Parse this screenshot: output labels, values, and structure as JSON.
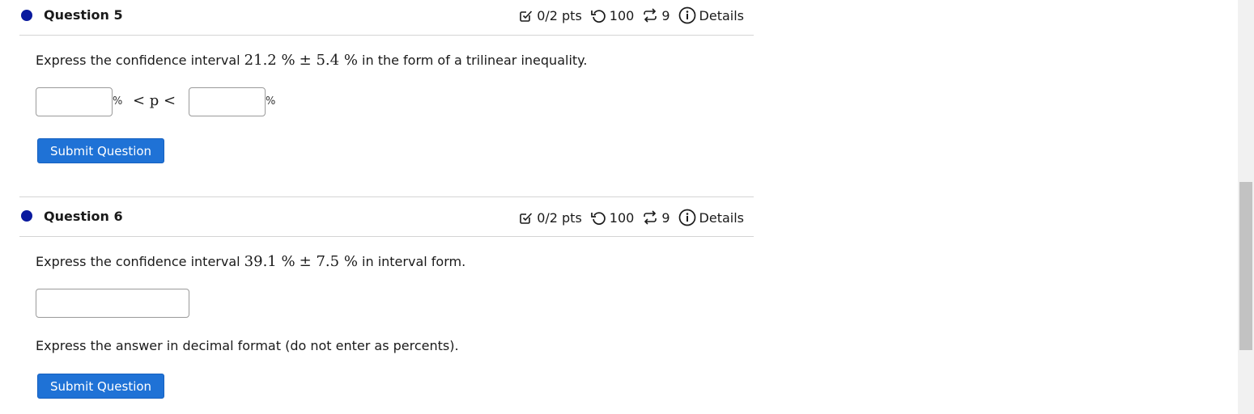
{
  "questions": [
    {
      "title": "Question 5",
      "meta": {
        "points": "0/2 pts",
        "attempts": "100",
        "retries": "9",
        "details": "Details"
      },
      "prompt": {
        "before": "Express the confidence interval ",
        "value": "21.2 %",
        "plusminus": "± 5.4 %",
        "after": " in the form of a trilinear inequality."
      },
      "inputs": {
        "left_value": "",
        "right_value": ""
      },
      "percent_sign": "%",
      "inequality": "< p <",
      "submit": "Submit Question"
    },
    {
      "title": "Question 6",
      "meta": {
        "points": "0/2 pts",
        "attempts": "100",
        "retries": "9",
        "details": "Details"
      },
      "prompt": {
        "before": "Express the confidence interval ",
        "value": "39.1 %",
        "plusminus": "± 7.5 %",
        "after": " in interval form."
      },
      "inputs": {
        "value": ""
      },
      "note": "Express the answer in decimal format (do not enter as percents).",
      "submit": "Submit Question"
    }
  ],
  "icons": {
    "bullet": "question-bullet-icon",
    "points": "checkbox-pencil-icon",
    "attempts": "undo-icon",
    "retries": "retry-icon",
    "details": "info-icon"
  },
  "colors": {
    "bullet": "#0a1a9e",
    "button": "#1f72d6",
    "divider": "#d4d4d4"
  }
}
